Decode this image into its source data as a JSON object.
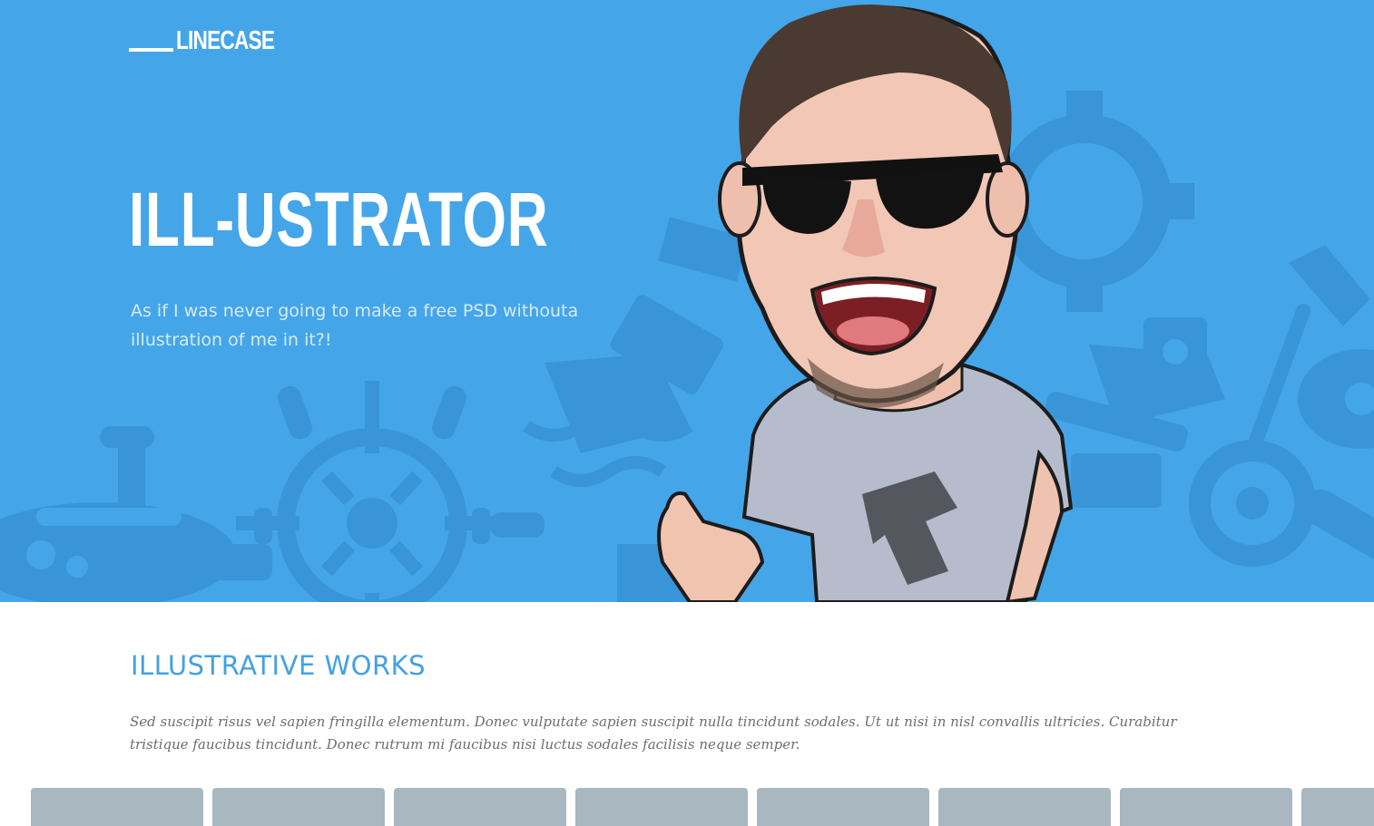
{
  "header": {
    "logo_text": "LINECASE"
  },
  "hero": {
    "title": "ILL-USTRATOR",
    "subtitle": "As if I was never going to make a free PSD withouta illustration of me in it?!",
    "background_color": "#45a5e9"
  },
  "works": {
    "title": "ILLUSTRATIVE WORKS",
    "description": "Sed suscipit risus vel sapien fringilla elementum. Donec vulputate sapien suscipit nulla tincidunt sodales. Ut ut nisi in nisl convallis ultricies. Curabitur tristique faucibus tincidunt. Donec rutrum mi faucibus nisi luctus sodales facilisis neque semper.",
    "thumbnail_color": "#a9b7c0",
    "thumbnail_count": 8
  },
  "colors": {
    "accent": "#43a1e3",
    "body_text": "#6e6e6e"
  },
  "icons": [
    "submarine-icon",
    "ship-wheel-icon",
    "ship-icon",
    "life-ring-icon",
    "boat-icon",
    "anchor-icon"
  ]
}
